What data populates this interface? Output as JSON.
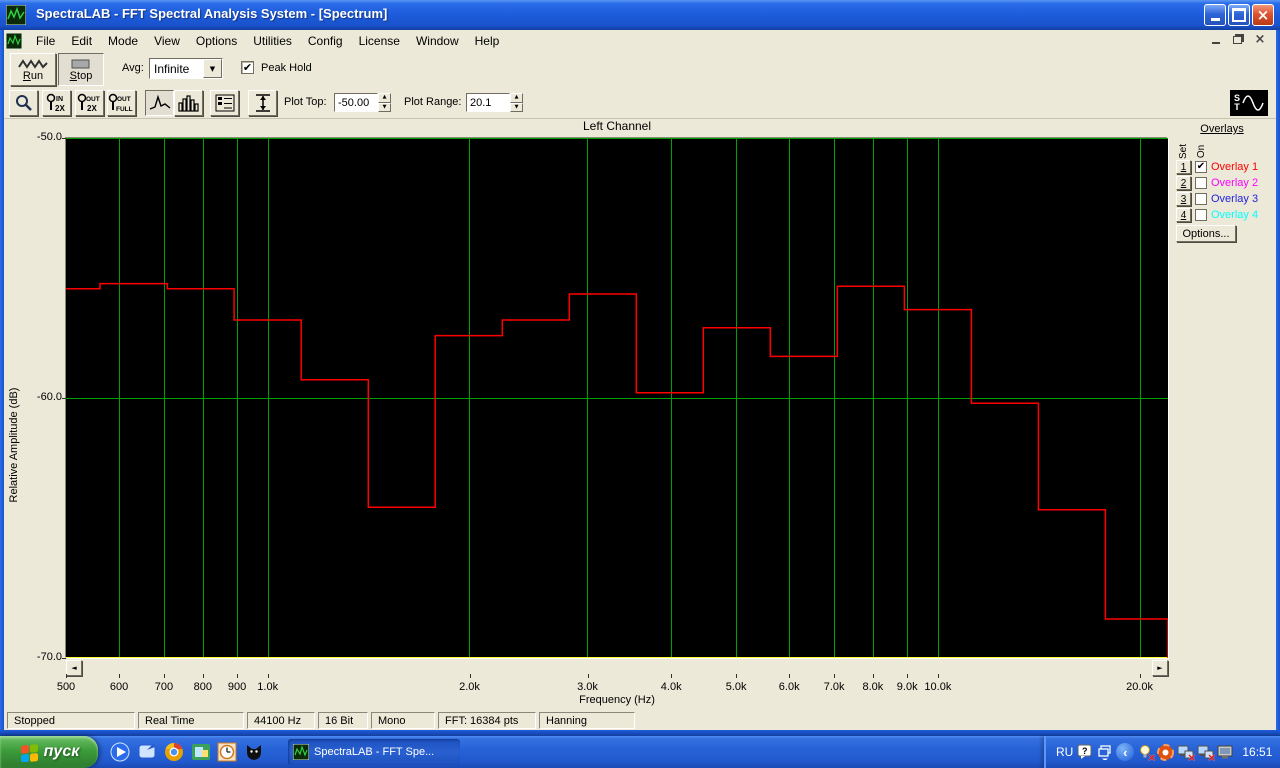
{
  "window": {
    "title": "SpectraLAB - FFT Spectral Analysis System - [Spectrum]"
  },
  "menu": {
    "items": [
      "File",
      "Edit",
      "Mode",
      "View",
      "Options",
      "Utilities",
      "Config",
      "License",
      "Window",
      "Help"
    ]
  },
  "toolbar1": {
    "run_label": "Run",
    "stop_label": "Stop",
    "avg_label": "Avg:",
    "avg_value": "Infinite",
    "peak_hold_label": "Peak Hold",
    "peak_hold_checked": true
  },
  "toolbar2": {
    "zoom_in_lines": [
      "IN",
      "2X"
    ],
    "zoom_out_lines": [
      "OUT",
      "2X"
    ],
    "zoom_full_lines": [
      "OUT",
      "FULL"
    ],
    "plot_top_label": "Plot Top:",
    "plot_top_value": "-50.00",
    "plot_range_label": "Plot Range:",
    "plot_range_value": "20.1",
    "logo_line1": "S",
    "logo_line2": "T"
  },
  "overlays": {
    "title": "Overlays",
    "set_label": "Set",
    "on_label": "On",
    "options_label": "Options...",
    "items": [
      {
        "num": "1",
        "label": "Overlay 1",
        "color": "#ff0000",
        "checked": true
      },
      {
        "num": "2",
        "label": "Overlay 2",
        "color": "#ff00ff",
        "checked": false
      },
      {
        "num": "3",
        "label": "Overlay 3",
        "color": "#2222dd",
        "checked": false
      },
      {
        "num": "4",
        "label": "Overlay 4",
        "color": "#00ffff",
        "checked": false
      }
    ]
  },
  "chart_data": {
    "type": "line",
    "subtype": "step-spectrum",
    "title": "Left Channel",
    "xlabel": "Frequency (Hz)",
    "ylabel": "Relative Amplitude (dB)",
    "x_scale": "log",
    "xlim_hz": [
      500,
      22050
    ],
    "ylim_db": [
      -70,
      -50
    ],
    "y_ticks": [
      {
        "db": -50,
        "label": "-50.0"
      },
      {
        "db": -60,
        "label": "-60.0"
      },
      {
        "db": -70,
        "label": "-70.0"
      }
    ],
    "x_ticks": [
      {
        "hz": 500,
        "label": "500"
      },
      {
        "hz": 600,
        "label": "600"
      },
      {
        "hz": 700,
        "label": "700"
      },
      {
        "hz": 800,
        "label": "800"
      },
      {
        "hz": 900,
        "label": "900"
      },
      {
        "hz": 1000,
        "label": "1.0k"
      },
      {
        "hz": 2000,
        "label": "2.0k"
      },
      {
        "hz": 3000,
        "label": "3.0k"
      },
      {
        "hz": 4000,
        "label": "4.0k"
      },
      {
        "hz": 5000,
        "label": "5.0k"
      },
      {
        "hz": 6000,
        "label": "6.0k"
      },
      {
        "hz": 7000,
        "label": "7.0k"
      },
      {
        "hz": 8000,
        "label": "8.0k"
      },
      {
        "hz": 9000,
        "label": "9.0k"
      },
      {
        "hz": 10000,
        "label": "10.0k"
      },
      {
        "hz": 20000,
        "label": "20.0k"
      }
    ],
    "grid_hz": [
      600,
      700,
      800,
      900,
      1000,
      2000,
      3000,
      4000,
      5000,
      6000,
      7000,
      8000,
      9000,
      10000,
      20000
    ],
    "grid_db": [
      -50,
      -60
    ],
    "series": [
      {
        "name": "Overlay 1",
        "color": "#ff0000",
        "band_edges_hz": [
          500,
          562,
          708,
          891,
          1122,
          1413,
          1778,
          2239,
          2818,
          3548,
          4467,
          5623,
          7079,
          8913,
          11220,
          14125,
          17783,
          22050
        ],
        "levels_db": [
          -55.8,
          -55.6,
          -55.8,
          -57.0,
          -59.3,
          -64.2,
          -57.6,
          -57.0,
          -56.0,
          -59.8,
          -57.3,
          -58.4,
          -55.7,
          -56.6,
          -60.2,
          -64.3,
          -68.5
        ],
        "end_drop_to_db": -70
      }
    ],
    "colors": {
      "plot_bg": "#000000",
      "grid": "#00a000",
      "baseline": "#ffff30",
      "trace": "#ff0000"
    },
    "legend_position": "none",
    "grid_on": true
  },
  "status_bar": {
    "panels": [
      "Stopped",
      "Real Time",
      "44100 Hz",
      "16 Bit",
      "Mono",
      "FFT: 16384 pts",
      "Hanning"
    ]
  },
  "taskbar": {
    "start_label": "пуск",
    "task_button_label": "SpectraLAB - FFT Spe...",
    "tray": {
      "lang": "RU",
      "time": "16:51"
    }
  },
  "glyphs": {
    "check": "✔",
    "left_arrow": "◄",
    "right_arrow": "►",
    "dropdown_arrow": "▼",
    "spin_up": "▲",
    "spin_down": "▼",
    "close_x": "×",
    "chevron": "‹",
    "question": "?",
    "cross": "×",
    "small_down": "▾"
  }
}
